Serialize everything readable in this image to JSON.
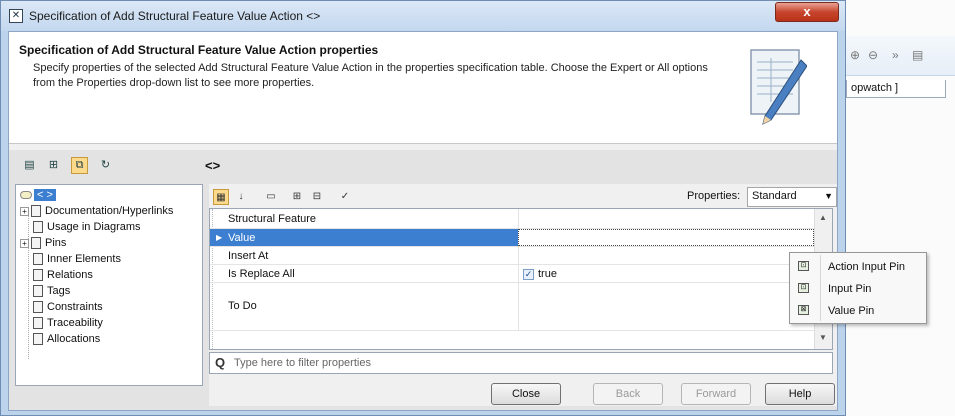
{
  "window": {
    "title": "Specification of Add Structural Feature Value Action <>",
    "close_label": "x"
  },
  "header": {
    "title": "Specification of Add Structural Feature Value Action properties",
    "description": "Specify properties of the selected Add Structural Feature Value Action in the properties specification table. Choose the Expert or All options from the Properties drop-down list to see more properties."
  },
  "breadcrumb": "<>",
  "tree": {
    "root_label": "< >",
    "items": [
      {
        "label": "Documentation/Hyperlinks",
        "expandable": true
      },
      {
        "label": "Usage in Diagrams",
        "expandable": false
      },
      {
        "label": "Pins",
        "expandable": true
      },
      {
        "label": "Inner Elements",
        "expandable": false
      },
      {
        "label": "Relations",
        "expandable": false
      },
      {
        "label": "Tags",
        "expandable": false
      },
      {
        "label": "Constraints",
        "expandable": false
      },
      {
        "label": "Traceability",
        "expandable": false
      },
      {
        "label": "Allocations",
        "expandable": false
      }
    ]
  },
  "properties": {
    "label": "Properties:",
    "selected": "Standard"
  },
  "grid": {
    "rows": [
      {
        "name": "Structural Feature",
        "value": ""
      },
      {
        "name": "Value",
        "value": ""
      },
      {
        "name": "Insert At",
        "value": ""
      },
      {
        "name": "Is Replace All",
        "value": "true",
        "checked": true
      },
      {
        "name": "To Do",
        "value": ""
      }
    ]
  },
  "filter": {
    "placeholder": "Type here to filter properties"
  },
  "buttons": {
    "close": "Close",
    "back": "Back",
    "forward": "Forward",
    "help": "Help"
  },
  "popup": {
    "items": [
      "Action Input Pin",
      "Input Pin",
      "Value Pin"
    ]
  },
  "background_app": {
    "tab_label": "opwatch ]",
    "toolbar_glyph": "»"
  }
}
